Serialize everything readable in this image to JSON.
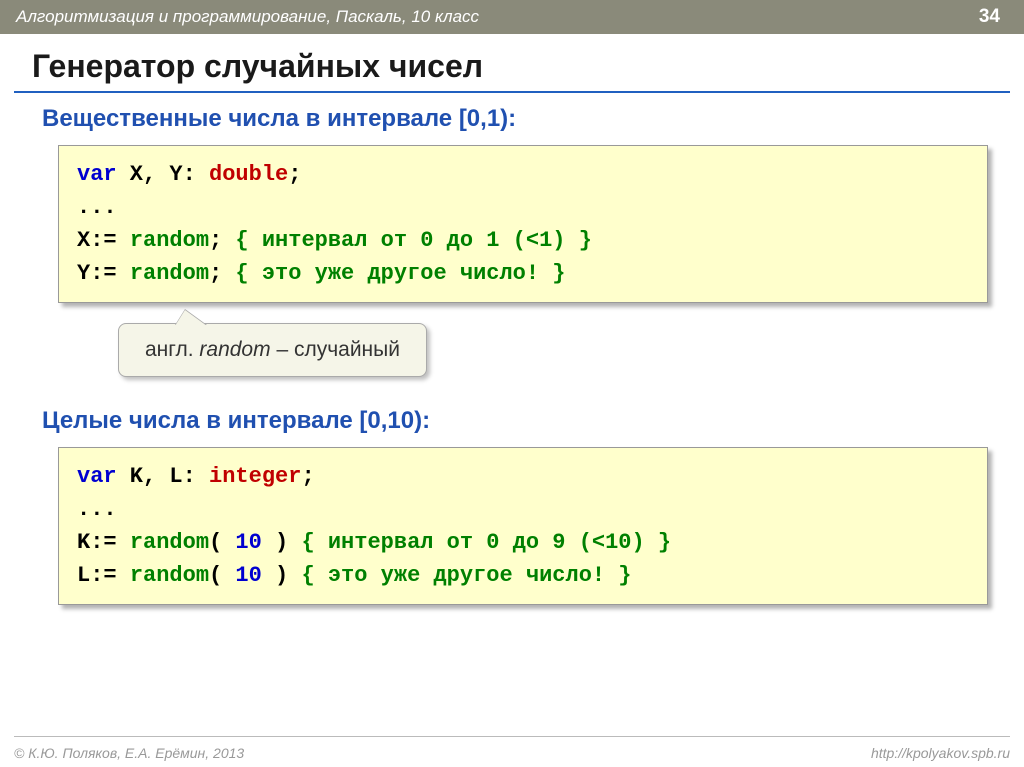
{
  "header": {
    "breadcrumb": "Алгоритмизация и программирование, Паскаль, 10 класс",
    "page_number": "34"
  },
  "title": "Генератор случайных чисел",
  "section1": {
    "heading": "Вещественные числа в интервале [0,1):",
    "code": {
      "l1_var": "var",
      "l1_decl": " X, Y: ",
      "l1_type": "double",
      "l1_semi": ";",
      "l2": "...",
      "l3_lhs": "X:= ",
      "l3_fn": "random",
      "l3_semi": ";",
      "l3_cm_open": " { ",
      "l3_cm": "интервал от 0 до 1 (<1)",
      "l3_cm_close": " }",
      "l4_lhs": "Y:= ",
      "l4_fn": "random",
      "l4_semi": ";",
      "l4_cm_open": " { ",
      "l4_cm": "это уже другое число!",
      "l4_cm_close": " }"
    }
  },
  "callout": {
    "prefix": "англ. ",
    "word": "random",
    "suffix": " – случайный"
  },
  "section2": {
    "heading": "Целые числа в интервале [0,10):",
    "code": {
      "l1_var": "var",
      "l1_decl": " K, L: ",
      "l1_type": "integer",
      "l1_semi": ";",
      "l2": "...",
      "l3_lhs": "K:= ",
      "l3_fn": "random",
      "l3_paren_o": "(",
      "l3_arg": " 10 ",
      "l3_paren_c": ")",
      "l3_cm_open": " { ",
      "l3_cm": "интервал от 0 до 9 (<10)",
      "l3_cm_close": " }",
      "l4_lhs": "L:= ",
      "l4_fn": "random",
      "l4_paren_o": "(",
      "l4_arg": " 10 ",
      "l4_paren_c": ")",
      "l4_cm_open": " { ",
      "l4_cm": "это уже другое число!",
      "l4_cm_close": " }"
    }
  },
  "footer": {
    "copyright": "© К.Ю. Поляков, Е.А. Ерёмин, 2013",
    "url": "http://kpolyakov.spb.ru"
  }
}
